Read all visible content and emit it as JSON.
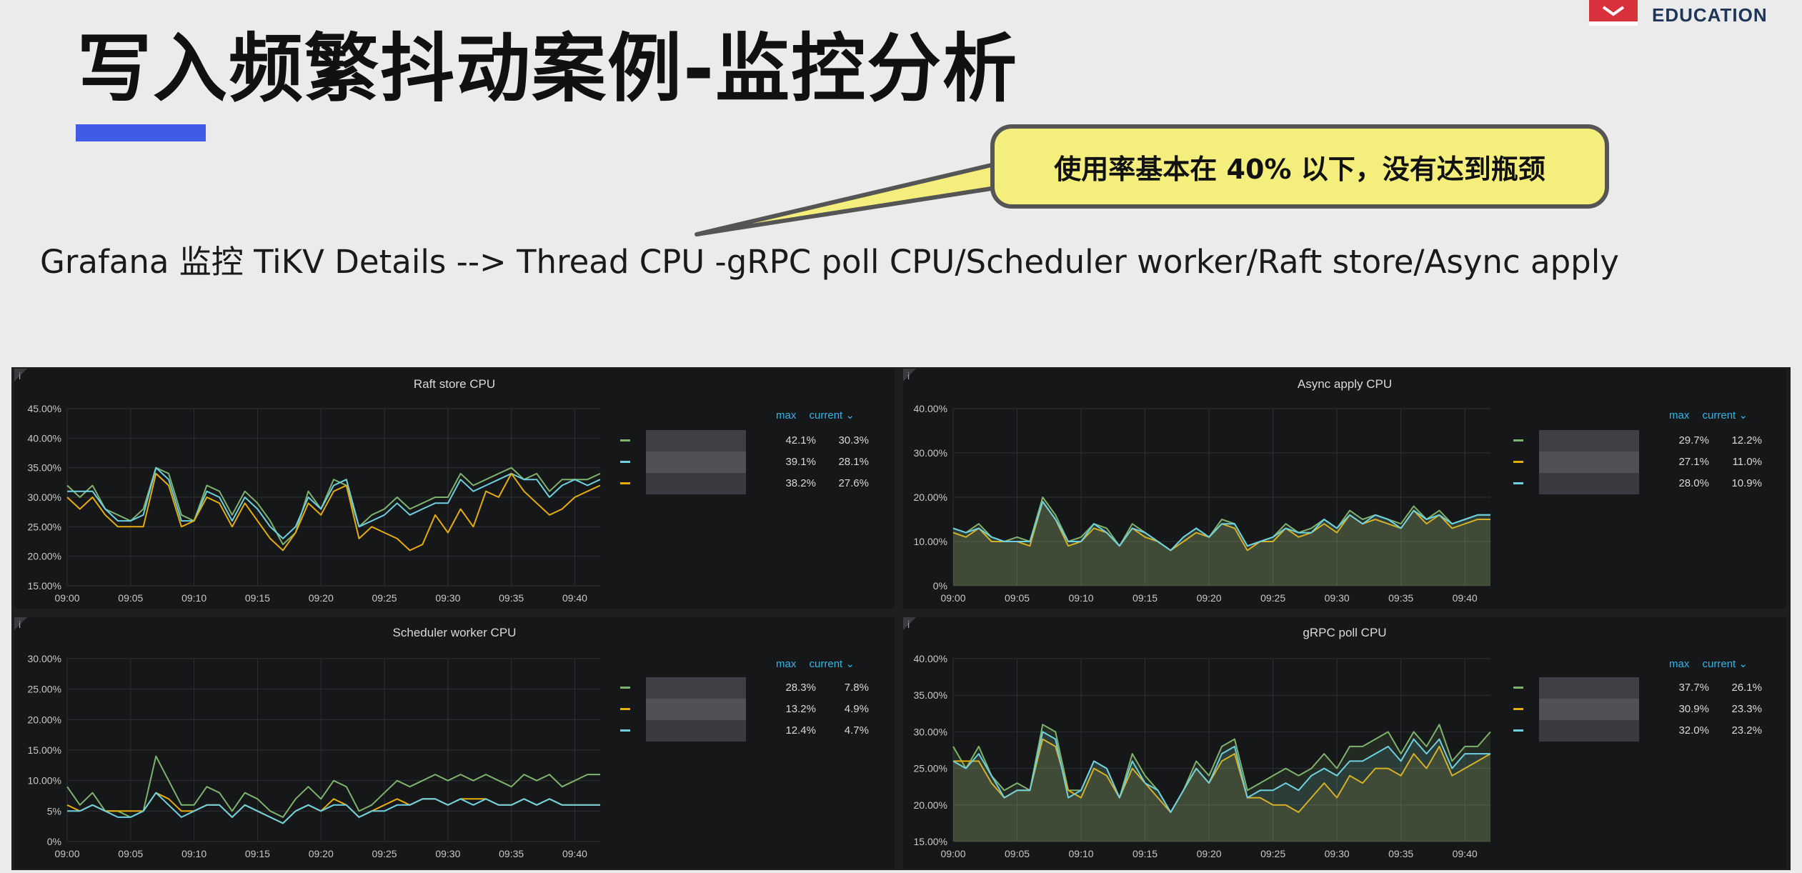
{
  "slide": {
    "title": "写入频繁抖动案例-监控分析",
    "callout": "使用率基本在 40% 以下，没有达到瓶颈",
    "subtitle": "Grafana 监控 TiKV Details --> Thread CPU -gRPC poll CPU/Scheduler worker/Raft store/Async apply",
    "brand": "EDUCATION",
    "accent_color": "#3f5be8"
  },
  "legend_labels": {
    "max": "max",
    "current": "current ⌄"
  },
  "panels": [
    {
      "key": "raft",
      "title": "Raft store CPU",
      "info_icon": "i",
      "fill": false,
      "y_ticks": [
        "45.00%",
        "40.00%",
        "35.00%",
        "30.00%",
        "25.00%",
        "20.00%",
        "15.00%"
      ],
      "x_ticks": [
        "09:00",
        "09:05",
        "09:10",
        "09:15",
        "09:20",
        "09:25",
        "09:30",
        "09:35",
        "09:40"
      ],
      "legend": [
        {
          "color": "#7eb26d",
          "max": "42.1%",
          "current": "30.3%"
        },
        {
          "color": "#6ed0e0",
          "max": "39.1%",
          "current": "28.1%"
        },
        {
          "color": "#e5ac0e",
          "max": "38.2%",
          "current": "27.6%"
        }
      ]
    },
    {
      "key": "async",
      "title": "Async apply CPU",
      "info_icon": "i",
      "fill": true,
      "y_ticks": [
        "40.00%",
        "30.00%",
        "20.00%",
        "10.00%",
        "0%"
      ],
      "x_ticks": [
        "09:00",
        "09:05",
        "09:10",
        "09:15",
        "09:20",
        "09:25",
        "09:30",
        "09:35",
        "09:40"
      ],
      "legend": [
        {
          "color": "#7eb26d",
          "max": "29.7%",
          "current": "12.2%"
        },
        {
          "color": "#e5ac0e",
          "max": "27.1%",
          "current": "11.0%"
        },
        {
          "color": "#6ed0e0",
          "max": "28.0%",
          "current": "10.9%"
        }
      ]
    },
    {
      "key": "scheduler",
      "title": "Scheduler worker CPU",
      "info_icon": "i",
      "fill": false,
      "y_ticks": [
        "30.00%",
        "25.00%",
        "20.00%",
        "15.00%",
        "10.00%",
        "5%",
        "0%"
      ],
      "x_ticks": [
        "09:00",
        "09:05",
        "09:10",
        "09:15",
        "09:20",
        "09:25",
        "09:30",
        "09:35",
        "09:40"
      ],
      "legend": [
        {
          "color": "#7eb26d",
          "max": "28.3%",
          "current": "7.8%"
        },
        {
          "color": "#e5ac0e",
          "max": "13.2%",
          "current": "4.9%"
        },
        {
          "color": "#6ed0e0",
          "max": "12.4%",
          "current": "4.7%"
        }
      ]
    },
    {
      "key": "grpc",
      "title": "gRPC poll CPU",
      "info_icon": "i",
      "fill": true,
      "y_ticks": [
        "40.00%",
        "35.00%",
        "30.00%",
        "25.00%",
        "20.00%",
        "15.00%"
      ],
      "x_ticks": [
        "09:00",
        "09:05",
        "09:10",
        "09:15",
        "09:20",
        "09:25",
        "09:30",
        "09:35",
        "09:40"
      ],
      "legend": [
        {
          "color": "#7eb26d",
          "max": "37.7%",
          "current": "26.1%"
        },
        {
          "color": "#e5ac0e",
          "max": "30.9%",
          "current": "23.3%"
        },
        {
          "color": "#6ed0e0",
          "max": "32.0%",
          "current": "23.2%"
        }
      ]
    }
  ],
  "chart_data": [
    {
      "type": "line",
      "title": "Raft store CPU",
      "ylim": [
        15,
        45
      ],
      "x": [
        "09:00",
        "09:01",
        "09:02",
        "09:03",
        "09:04",
        "09:05",
        "09:06",
        "09:07",
        "09:08",
        "09:09",
        "09:10",
        "09:11",
        "09:12",
        "09:13",
        "09:14",
        "09:15",
        "09:16",
        "09:17",
        "09:18",
        "09:19",
        "09:20",
        "09:21",
        "09:22",
        "09:23",
        "09:24",
        "09:25",
        "09:26",
        "09:27",
        "09:28",
        "09:29",
        "09:30",
        "09:31",
        "09:32",
        "09:33",
        "09:34",
        "09:35",
        "09:36",
        "09:37",
        "09:38",
        "09:39",
        "09:40",
        "09:41",
        "09:42"
      ],
      "series": [
        {
          "color": "#7eb26d",
          "values": [
            32,
            30,
            32,
            28,
            27,
            26,
            28,
            35,
            34,
            27,
            26,
            32,
            31,
            27,
            31,
            29,
            26,
            22,
            24,
            31,
            28,
            33,
            32,
            25,
            27,
            28,
            30,
            28,
            29,
            30,
            30,
            34,
            32,
            33,
            34,
            35,
            33,
            34,
            31,
            33,
            33,
            33,
            34
          ]
        },
        {
          "color": "#6ed0e0",
          "values": [
            31,
            31,
            31,
            28,
            26,
            26,
            27,
            35,
            33,
            26,
            26,
            31,
            30,
            26,
            30,
            28,
            25,
            23,
            25,
            30,
            28,
            32,
            33,
            25,
            26,
            27,
            29,
            27,
            28,
            29,
            29,
            33,
            31,
            32,
            33,
            34,
            33,
            33,
            30,
            32,
            33,
            32,
            33
          ]
        },
        {
          "color": "#e5ac0e",
          "values": [
            30,
            28,
            30,
            27,
            25,
            25,
            25,
            34,
            32,
            25,
            26,
            30,
            29,
            25,
            29,
            26,
            23,
            21,
            24,
            29,
            27,
            31,
            32,
            23,
            25,
            24,
            23,
            21,
            22,
            27,
            24,
            28,
            25,
            31,
            30,
            34,
            31,
            29,
            27,
            28,
            30,
            31,
            32
          ]
        }
      ]
    },
    {
      "type": "area",
      "title": "Async apply CPU",
      "ylim": [
        0,
        40
      ],
      "x": [
        "09:00",
        "09:01",
        "09:02",
        "09:03",
        "09:04",
        "09:05",
        "09:06",
        "09:07",
        "09:08",
        "09:09",
        "09:10",
        "09:11",
        "09:12",
        "09:13",
        "09:14",
        "09:15",
        "09:16",
        "09:17",
        "09:18",
        "09:19",
        "09:20",
        "09:21",
        "09:22",
        "09:23",
        "09:24",
        "09:25",
        "09:26",
        "09:27",
        "09:28",
        "09:29",
        "09:30",
        "09:31",
        "09:32",
        "09:33",
        "09:34",
        "09:35",
        "09:36",
        "09:37",
        "09:38",
        "09:39",
        "09:40",
        "09:41",
        "09:42"
      ],
      "series": [
        {
          "color": "#7eb26d",
          "values": [
            13,
            12,
            14,
            11,
            10,
            11,
            10,
            20,
            16,
            10,
            11,
            14,
            13,
            9,
            14,
            12,
            10,
            8,
            11,
            13,
            11,
            15,
            14,
            9,
            10,
            11,
            14,
            12,
            13,
            15,
            13,
            17,
            15,
            16,
            15,
            14,
            18,
            15,
            17,
            14,
            15,
            16,
            16
          ]
        },
        {
          "color": "#e5ac0e",
          "values": [
            12,
            11,
            13,
            10,
            10,
            10,
            9,
            19,
            15,
            9,
            10,
            13,
            12,
            9,
            13,
            11,
            10,
            8,
            10,
            12,
            11,
            14,
            13,
            8,
            10,
            10,
            13,
            11,
            12,
            14,
            12,
            16,
            14,
            15,
            14,
            13,
            17,
            14,
            16,
            13,
            14,
            15,
            15
          ]
        },
        {
          "color": "#6ed0e0",
          "values": [
            13,
            12,
            13,
            11,
            10,
            10,
            10,
            19,
            15,
            10,
            10,
            14,
            12,
            9,
            13,
            12,
            10,
            8,
            11,
            13,
            11,
            14,
            14,
            9,
            10,
            11,
            13,
            12,
            12,
            15,
            13,
            16,
            14,
            16,
            15,
            13,
            17,
            15,
            16,
            14,
            15,
            16,
            16
          ]
        }
      ]
    },
    {
      "type": "line",
      "title": "Scheduler worker CPU",
      "ylim": [
        0,
        30
      ],
      "x": [
        "09:00",
        "09:01",
        "09:02",
        "09:03",
        "09:04",
        "09:05",
        "09:06",
        "09:07",
        "09:08",
        "09:09",
        "09:10",
        "09:11",
        "09:12",
        "09:13",
        "09:14",
        "09:15",
        "09:16",
        "09:17",
        "09:18",
        "09:19",
        "09:20",
        "09:21",
        "09:22",
        "09:23",
        "09:24",
        "09:25",
        "09:26",
        "09:27",
        "09:28",
        "09:29",
        "09:30",
        "09:31",
        "09:32",
        "09:33",
        "09:34",
        "09:35",
        "09:36",
        "09:37",
        "09:38",
        "09:39",
        "09:40",
        "09:41",
        "09:42"
      ],
      "series": [
        {
          "color": "#7eb26d",
          "values": [
            9,
            6,
            8,
            5,
            5,
            4,
            5,
            14,
            10,
            6,
            6,
            9,
            8,
            5,
            8,
            7,
            5,
            4,
            7,
            9,
            7,
            10,
            9,
            5,
            6,
            8,
            10,
            9,
            10,
            11,
            10,
            11,
            10,
            11,
            10,
            9,
            11,
            10,
            11,
            9,
            10,
            11,
            11
          ]
        },
        {
          "color": "#e5ac0e",
          "values": [
            6,
            5,
            6,
            5,
            5,
            5,
            5,
            8,
            7,
            5,
            5,
            6,
            6,
            4,
            6,
            5,
            4,
            3,
            5,
            6,
            5,
            7,
            6,
            4,
            5,
            6,
            7,
            6,
            7,
            7,
            6,
            7,
            7,
            7,
            6,
            6,
            7,
            6,
            7,
            6,
            6,
            6,
            6
          ]
        },
        {
          "color": "#6ed0e0",
          "values": [
            5,
            5,
            6,
            5,
            4,
            4,
            5,
            8,
            6,
            4,
            5,
            6,
            6,
            4,
            6,
            5,
            4,
            3,
            5,
            6,
            5,
            6,
            6,
            4,
            5,
            5,
            6,
            6,
            7,
            7,
            6,
            7,
            6,
            7,
            6,
            6,
            7,
            6,
            7,
            6,
            6,
            6,
            6
          ]
        }
      ]
    },
    {
      "type": "area",
      "title": "gRPC poll CPU",
      "ylim": [
        15,
        40
      ],
      "x": [
        "09:00",
        "09:01",
        "09:02",
        "09:03",
        "09:04",
        "09:05",
        "09:06",
        "09:07",
        "09:08",
        "09:09",
        "09:10",
        "09:11",
        "09:12",
        "09:13",
        "09:14",
        "09:15",
        "09:16",
        "09:17",
        "09:18",
        "09:19",
        "09:20",
        "09:21",
        "09:22",
        "09:23",
        "09:24",
        "09:25",
        "09:26",
        "09:27",
        "09:28",
        "09:29",
        "09:30",
        "09:31",
        "09:32",
        "09:33",
        "09:34",
        "09:35",
        "09:36",
        "09:37",
        "09:38",
        "09:39",
        "09:40",
        "09:41",
        "09:42"
      ],
      "series": [
        {
          "color": "#7eb26d",
          "values": [
            28,
            25,
            28,
            24,
            22,
            23,
            22,
            31,
            30,
            22,
            22,
            26,
            25,
            21,
            27,
            24,
            22,
            19,
            22,
            26,
            24,
            28,
            29,
            22,
            23,
            24,
            25,
            24,
            25,
            27,
            25,
            28,
            28,
            29,
            30,
            27,
            30,
            28,
            31,
            26,
            28,
            28,
            30
          ]
        },
        {
          "color": "#e5ac0e",
          "values": [
            26,
            26,
            26,
            23,
            21,
            22,
            22,
            29,
            28,
            22,
            21,
            25,
            24,
            21,
            25,
            23,
            21,
            19,
            22,
            25,
            23,
            26,
            27,
            21,
            21,
            20,
            20,
            19,
            21,
            23,
            21,
            24,
            23,
            25,
            25,
            24,
            27,
            25,
            28,
            24,
            25,
            26,
            27
          ]
        },
        {
          "color": "#6ed0e0",
          "values": [
            26,
            25,
            27,
            24,
            21,
            22,
            22,
            30,
            29,
            21,
            22,
            26,
            25,
            21,
            26,
            23,
            22,
            19,
            22,
            25,
            23,
            27,
            28,
            21,
            22,
            22,
            23,
            22,
            24,
            25,
            24,
            26,
            26,
            27,
            28,
            26,
            29,
            27,
            29,
            25,
            27,
            27,
            27
          ]
        }
      ]
    }
  ]
}
